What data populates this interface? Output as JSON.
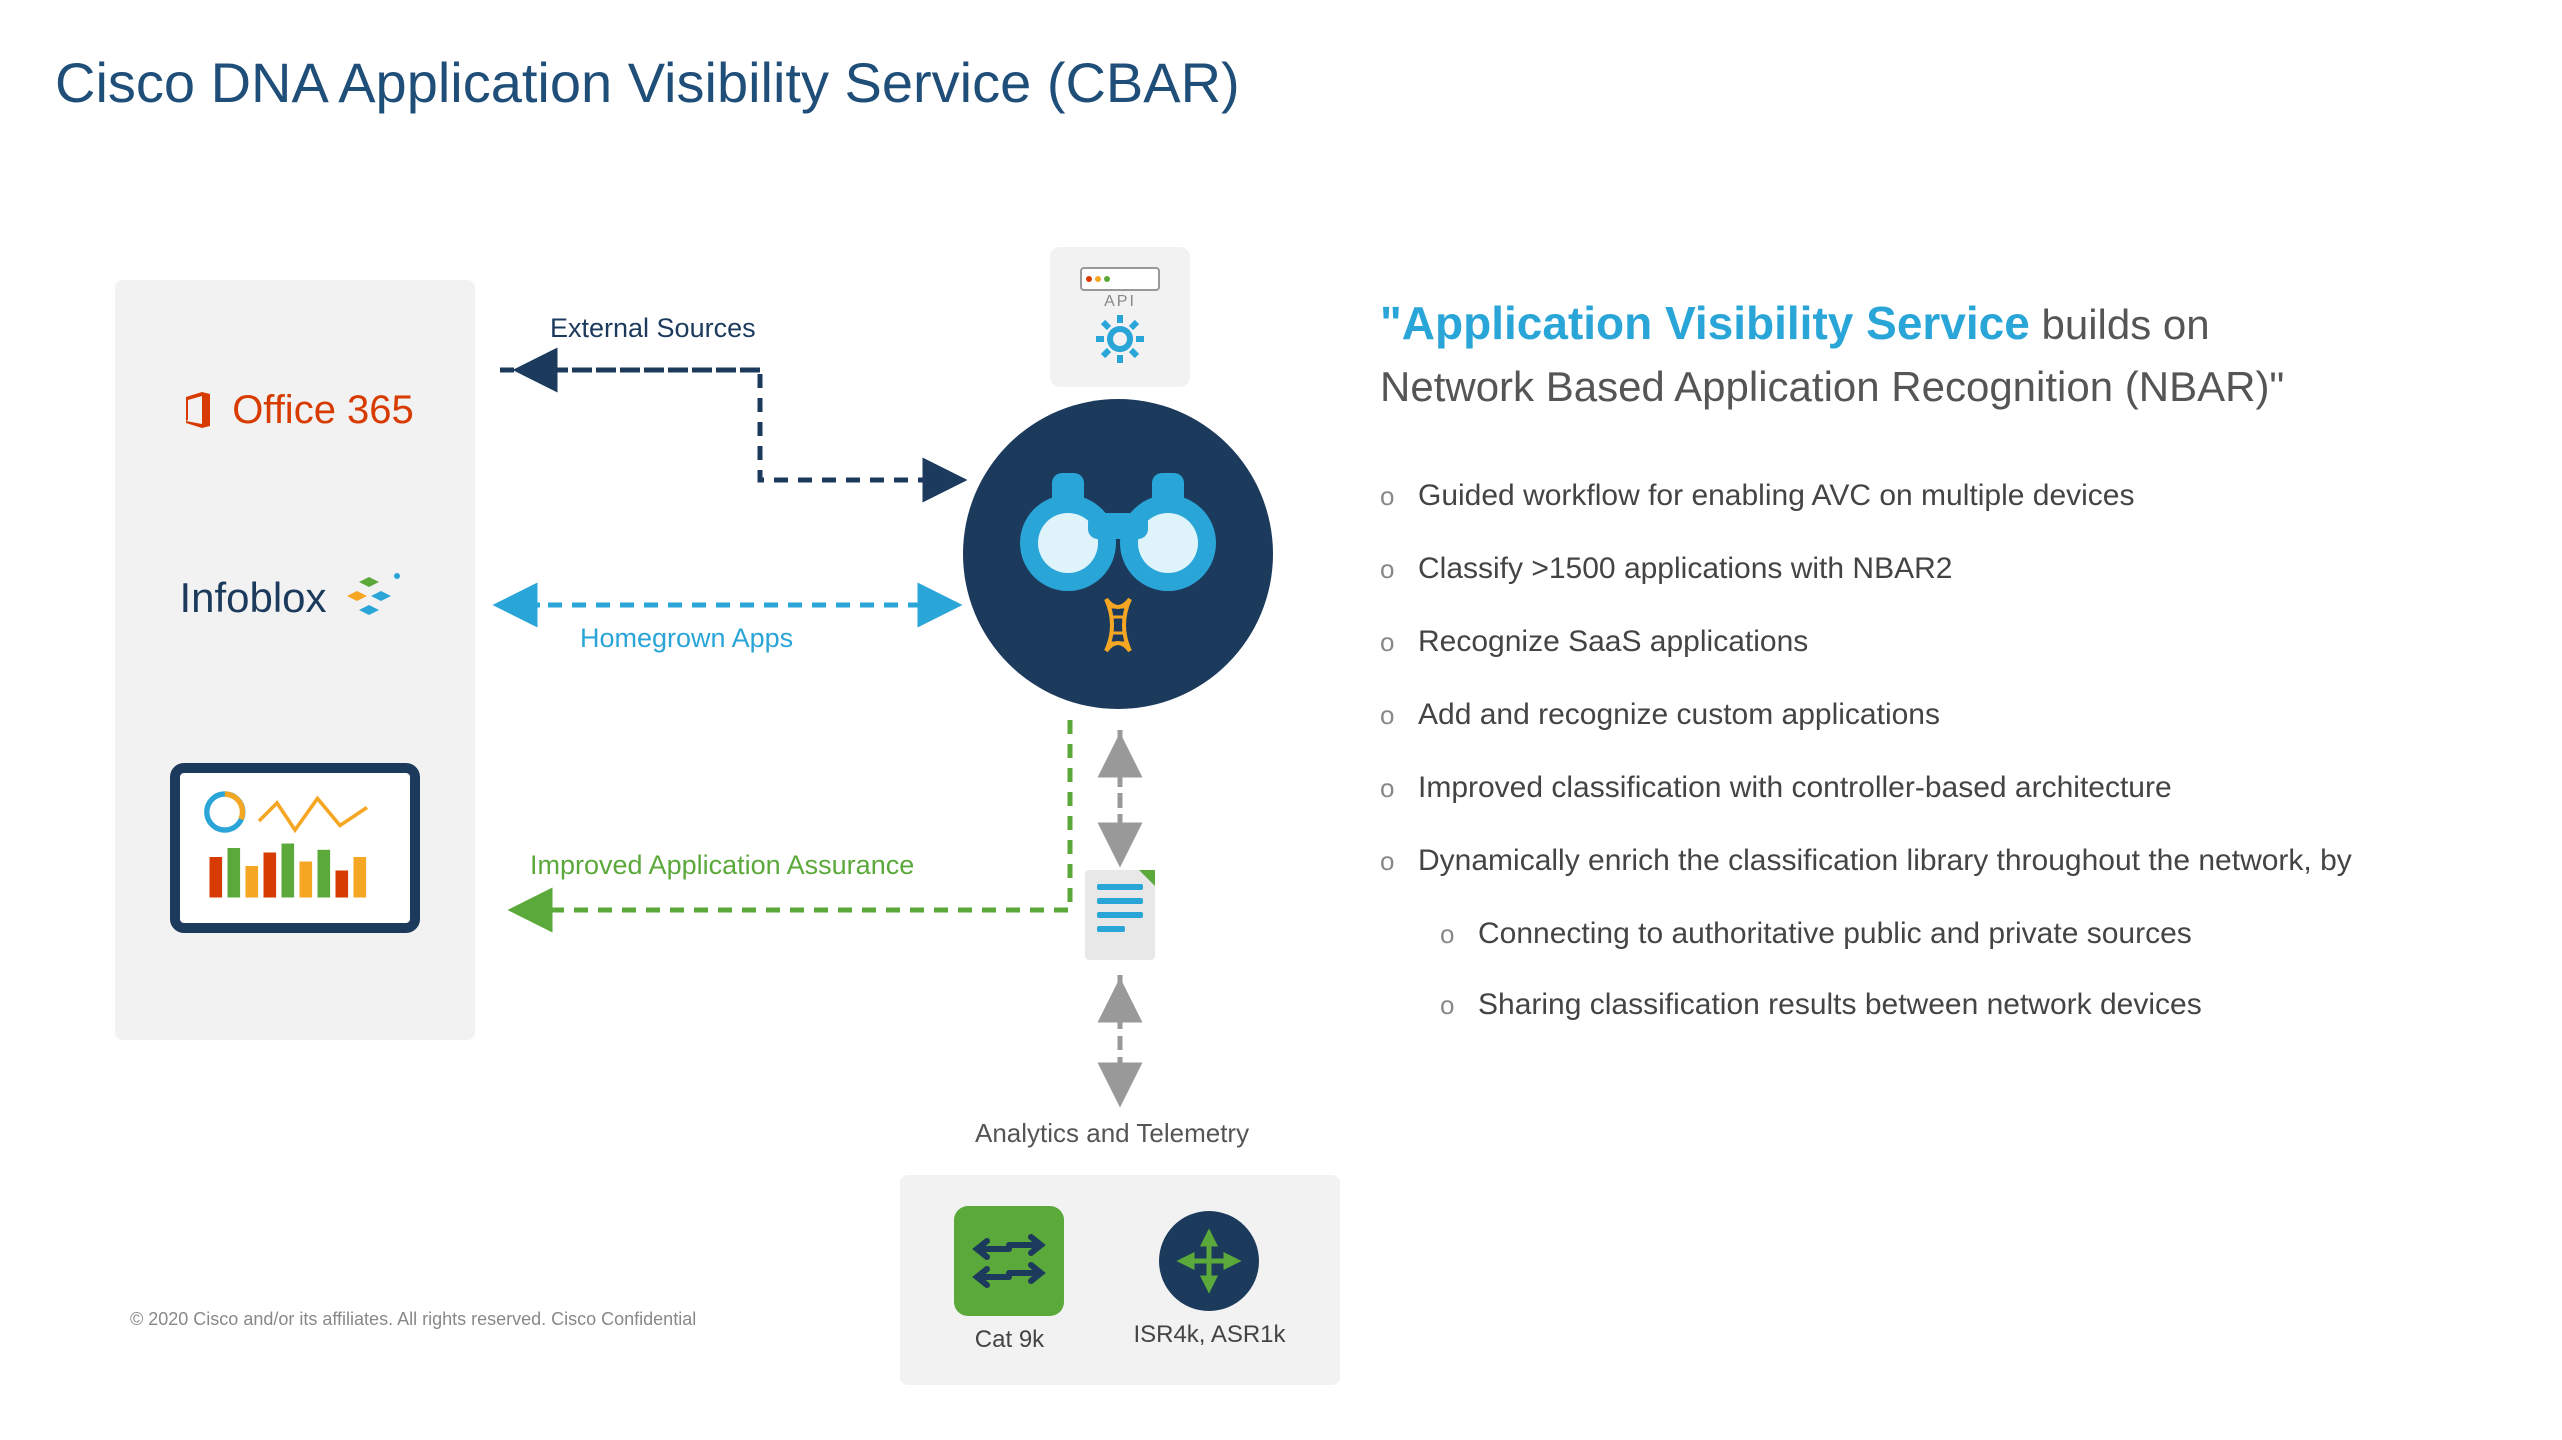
{
  "title": "Cisco DNA Application Visibility Service (CBAR)",
  "left_panel": {
    "office365": "Office 365",
    "infoblox": "Infoblox"
  },
  "connectors": {
    "external": "External Sources",
    "homegrown": "Homegrown Apps",
    "assurance": "Improved Application Assurance",
    "analytics": "Analytics and Telemetry"
  },
  "api_label": "API",
  "devices": {
    "cat9k": "Cat 9k",
    "isr": "ISR4k, ASR1k"
  },
  "quote": {
    "lead": "\"Application Visibility Service",
    "body1": " builds on",
    "body2": "Network Based Application Recognition (NBAR)\""
  },
  "bullets": [
    "Guided workflow for enabling AVC on multiple devices",
    "Classify >1500 applications with NBAR2",
    "Recognize SaaS applications",
    "Add and recognize custom applications",
    "Improved classification with controller-based architecture",
    "Dynamically enrich the classification library throughout the network, by"
  ],
  "sub_bullets": [
    "Connecting to authoritative public and private sources",
    "Sharing classification results between network devices"
  ],
  "footer": "© 2020  Cisco and/or its affiliates. All rights reserved.   Cisco Confidential",
  "colors": {
    "title": "#1f4e79",
    "accent_blue": "#2aa5d8",
    "dark_navy": "#1b3a5c",
    "orange": "#d83b01",
    "green": "#5ba83b",
    "gray_bg": "#f2f2f2"
  }
}
